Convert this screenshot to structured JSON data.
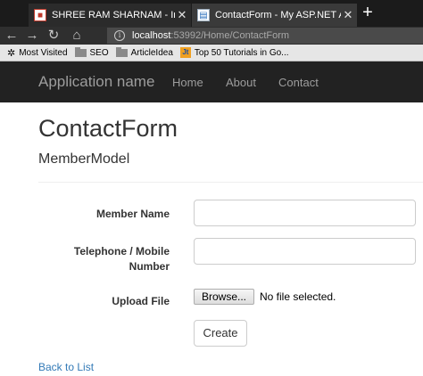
{
  "browser": {
    "tabs": [
      {
        "title": "SHREE RAM SHARNAM - Intern",
        "icon": "site-favicon",
        "close": "✕",
        "active": false
      },
      {
        "title": "ContactForm - My ASP.NET Ap",
        "icon": "page-icon",
        "close": "✕",
        "active": true
      }
    ],
    "new_tab": "+",
    "url": {
      "host": "localhost",
      "path": ":53992/Home/ContactForm"
    },
    "bookmarks": [
      {
        "label": "Most Visited",
        "icon": "gear-icon"
      },
      {
        "label": "SEO",
        "icon": "folder-icon"
      },
      {
        "label": "ArticleIdea",
        "icon": "folder-icon"
      },
      {
        "label": "Top 50 Tutorials in Go...",
        "icon": "jt-favicon",
        "icon_text": "Jt"
      }
    ]
  },
  "site": {
    "brand": "Application name",
    "nav": [
      "Home",
      "About",
      "Contact"
    ]
  },
  "page": {
    "title": "ContactForm",
    "subtitle": "MemberModel",
    "fields": {
      "member_name": {
        "label": "Member Name",
        "value": ""
      },
      "telephone": {
        "label_line1": "Telephone / Mobile",
        "label_line2": "Number",
        "value": ""
      },
      "upload": {
        "label": "Upload File",
        "button": "Browse...",
        "status": "No file selected."
      }
    },
    "create_button": "Create",
    "back_link": "Back to List"
  },
  "colors": {
    "navbar_bg": "#222222",
    "nav_text": "#9d9d9d",
    "link": "#337ab7",
    "text": "#333333"
  }
}
